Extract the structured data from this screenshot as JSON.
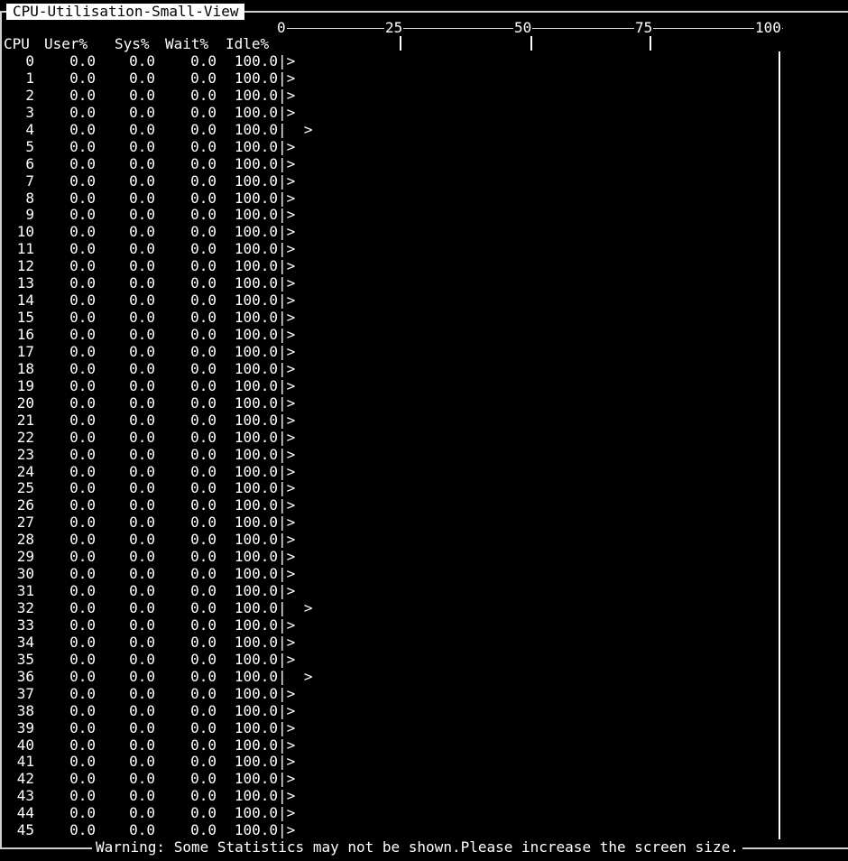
{
  "title": "CPU-Utilisation-Small-View",
  "scale": {
    "ticks": [
      "0",
      "25",
      "50",
      "75",
      "100"
    ]
  },
  "columns": {
    "cpu": "CPU",
    "user": "User%",
    "sys": "Sys%",
    "wait": "Wait%",
    "idle": "Idle%"
  },
  "rows": [
    {
      "cpu": "0",
      "user": "0.0",
      "sys": "0.0",
      "wait": "0.0",
      "idle": "100.0",
      "bar": "|>"
    },
    {
      "cpu": "1",
      "user": "0.0",
      "sys": "0.0",
      "wait": "0.0",
      "idle": "100.0",
      "bar": "|>"
    },
    {
      "cpu": "2",
      "user": "0.0",
      "sys": "0.0",
      "wait": "0.0",
      "idle": "100.0",
      "bar": "|>"
    },
    {
      "cpu": "3",
      "user": "0.0",
      "sys": "0.0",
      "wait": "0.0",
      "idle": "100.0",
      "bar": "|>"
    },
    {
      "cpu": "4",
      "user": "0.0",
      "sys": "0.0",
      "wait": "0.0",
      "idle": "100.0",
      "bar": "|  >"
    },
    {
      "cpu": "5",
      "user": "0.0",
      "sys": "0.0",
      "wait": "0.0",
      "idle": "100.0",
      "bar": "|>"
    },
    {
      "cpu": "6",
      "user": "0.0",
      "sys": "0.0",
      "wait": "0.0",
      "idle": "100.0",
      "bar": "|>"
    },
    {
      "cpu": "7",
      "user": "0.0",
      "sys": "0.0",
      "wait": "0.0",
      "idle": "100.0",
      "bar": "|>"
    },
    {
      "cpu": "8",
      "user": "0.0",
      "sys": "0.0",
      "wait": "0.0",
      "idle": "100.0",
      "bar": "|>"
    },
    {
      "cpu": "9",
      "user": "0.0",
      "sys": "0.0",
      "wait": "0.0",
      "idle": "100.0",
      "bar": "|>"
    },
    {
      "cpu": "10",
      "user": "0.0",
      "sys": "0.0",
      "wait": "0.0",
      "idle": "100.0",
      "bar": "|>"
    },
    {
      "cpu": "11",
      "user": "0.0",
      "sys": "0.0",
      "wait": "0.0",
      "idle": "100.0",
      "bar": "|>"
    },
    {
      "cpu": "12",
      "user": "0.0",
      "sys": "0.0",
      "wait": "0.0",
      "idle": "100.0",
      "bar": "|>"
    },
    {
      "cpu": "13",
      "user": "0.0",
      "sys": "0.0",
      "wait": "0.0",
      "idle": "100.0",
      "bar": "|>"
    },
    {
      "cpu": "14",
      "user": "0.0",
      "sys": "0.0",
      "wait": "0.0",
      "idle": "100.0",
      "bar": "|>"
    },
    {
      "cpu": "15",
      "user": "0.0",
      "sys": "0.0",
      "wait": "0.0",
      "idle": "100.0",
      "bar": "|>"
    },
    {
      "cpu": "16",
      "user": "0.0",
      "sys": "0.0",
      "wait": "0.0",
      "idle": "100.0",
      "bar": "|>"
    },
    {
      "cpu": "17",
      "user": "0.0",
      "sys": "0.0",
      "wait": "0.0",
      "idle": "100.0",
      "bar": "|>"
    },
    {
      "cpu": "18",
      "user": "0.0",
      "sys": "0.0",
      "wait": "0.0",
      "idle": "100.0",
      "bar": "|>"
    },
    {
      "cpu": "19",
      "user": "0.0",
      "sys": "0.0",
      "wait": "0.0",
      "idle": "100.0",
      "bar": "|>"
    },
    {
      "cpu": "20",
      "user": "0.0",
      "sys": "0.0",
      "wait": "0.0",
      "idle": "100.0",
      "bar": "|>"
    },
    {
      "cpu": "21",
      "user": "0.0",
      "sys": "0.0",
      "wait": "0.0",
      "idle": "100.0",
      "bar": "|>"
    },
    {
      "cpu": "22",
      "user": "0.0",
      "sys": "0.0",
      "wait": "0.0",
      "idle": "100.0",
      "bar": "|>"
    },
    {
      "cpu": "23",
      "user": "0.0",
      "sys": "0.0",
      "wait": "0.0",
      "idle": "100.0",
      "bar": "|>"
    },
    {
      "cpu": "24",
      "user": "0.0",
      "sys": "0.0",
      "wait": "0.0",
      "idle": "100.0",
      "bar": "|>"
    },
    {
      "cpu": "25",
      "user": "0.0",
      "sys": "0.0",
      "wait": "0.0",
      "idle": "100.0",
      "bar": "|>"
    },
    {
      "cpu": "26",
      "user": "0.0",
      "sys": "0.0",
      "wait": "0.0",
      "idle": "100.0",
      "bar": "|>"
    },
    {
      "cpu": "27",
      "user": "0.0",
      "sys": "0.0",
      "wait": "0.0",
      "idle": "100.0",
      "bar": "|>"
    },
    {
      "cpu": "28",
      "user": "0.0",
      "sys": "0.0",
      "wait": "0.0",
      "idle": "100.0",
      "bar": "|>"
    },
    {
      "cpu": "29",
      "user": "0.0",
      "sys": "0.0",
      "wait": "0.0",
      "idle": "100.0",
      "bar": "|>"
    },
    {
      "cpu": "30",
      "user": "0.0",
      "sys": "0.0",
      "wait": "0.0",
      "idle": "100.0",
      "bar": "|>"
    },
    {
      "cpu": "31",
      "user": "0.0",
      "sys": "0.0",
      "wait": "0.0",
      "idle": "100.0",
      "bar": "|>"
    },
    {
      "cpu": "32",
      "user": "0.0",
      "sys": "0.0",
      "wait": "0.0",
      "idle": "100.0",
      "bar": "|  >"
    },
    {
      "cpu": "33",
      "user": "0.0",
      "sys": "0.0",
      "wait": "0.0",
      "idle": "100.0",
      "bar": "|>"
    },
    {
      "cpu": "34",
      "user": "0.0",
      "sys": "0.0",
      "wait": "0.0",
      "idle": "100.0",
      "bar": "|>"
    },
    {
      "cpu": "35",
      "user": "0.0",
      "sys": "0.0",
      "wait": "0.0",
      "idle": "100.0",
      "bar": "|>"
    },
    {
      "cpu": "36",
      "user": "0.0",
      "sys": "0.0",
      "wait": "0.0",
      "idle": "100.0",
      "bar": "|  >"
    },
    {
      "cpu": "37",
      "user": "0.0",
      "sys": "0.0",
      "wait": "0.0",
      "idle": "100.0",
      "bar": "|>"
    },
    {
      "cpu": "38",
      "user": "0.0",
      "sys": "0.0",
      "wait": "0.0",
      "idle": "100.0",
      "bar": "|>"
    },
    {
      "cpu": "39",
      "user": "0.0",
      "sys": "0.0",
      "wait": "0.0",
      "idle": "100.0",
      "bar": "|>"
    },
    {
      "cpu": "40",
      "user": "0.0",
      "sys": "0.0",
      "wait": "0.0",
      "idle": "100.0",
      "bar": "|>"
    },
    {
      "cpu": "41",
      "user": "0.0",
      "sys": "0.0",
      "wait": "0.0",
      "idle": "100.0",
      "bar": "|>"
    },
    {
      "cpu": "42",
      "user": "0.0",
      "sys": "0.0",
      "wait": "0.0",
      "idle": "100.0",
      "bar": "|>"
    },
    {
      "cpu": "43",
      "user": "0.0",
      "sys": "0.0",
      "wait": "0.0",
      "idle": "100.0",
      "bar": "|>"
    },
    {
      "cpu": "44",
      "user": "0.0",
      "sys": "0.0",
      "wait": "0.0",
      "idle": "100.0",
      "bar": "|>"
    },
    {
      "cpu": "45",
      "user": "0.0",
      "sys": "0.0",
      "wait": "0.0",
      "idle": "100.0",
      "bar": "|>"
    }
  ],
  "warning": "Warning: Some Statistics may not be shown.Please increase the screen size.",
  "colors": {
    "background": "#000000",
    "foreground": "#ffffff",
    "title_bg": "#ffffff",
    "title_fg": "#000000"
  }
}
